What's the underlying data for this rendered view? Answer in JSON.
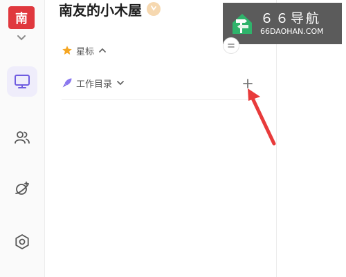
{
  "workspace": {
    "avatar_text": "南"
  },
  "rail": {
    "items": [
      {
        "name": "desktop",
        "icon": "monitor-icon",
        "active": true
      },
      {
        "name": "contacts",
        "icon": "users-icon",
        "active": false
      },
      {
        "name": "explore",
        "icon": "planet-icon",
        "active": false
      },
      {
        "name": "settings",
        "icon": "hexagon-settings-icon",
        "active": false
      }
    ]
  },
  "panel": {
    "title": "南友的小木屋",
    "sections": {
      "starred": {
        "label": "星标",
        "icon": "star-icon"
      },
      "work_dir": {
        "label": "工作目录",
        "icon": "rocket-icon"
      }
    }
  },
  "watermark": {
    "title": "６６导航",
    "url": "66DAOHAN.COM"
  },
  "colors": {
    "accent": "#6f5ce0",
    "avatar_bg": "#e0383e",
    "annotation_red": "#e83b3b",
    "star": "#f5a623"
  }
}
